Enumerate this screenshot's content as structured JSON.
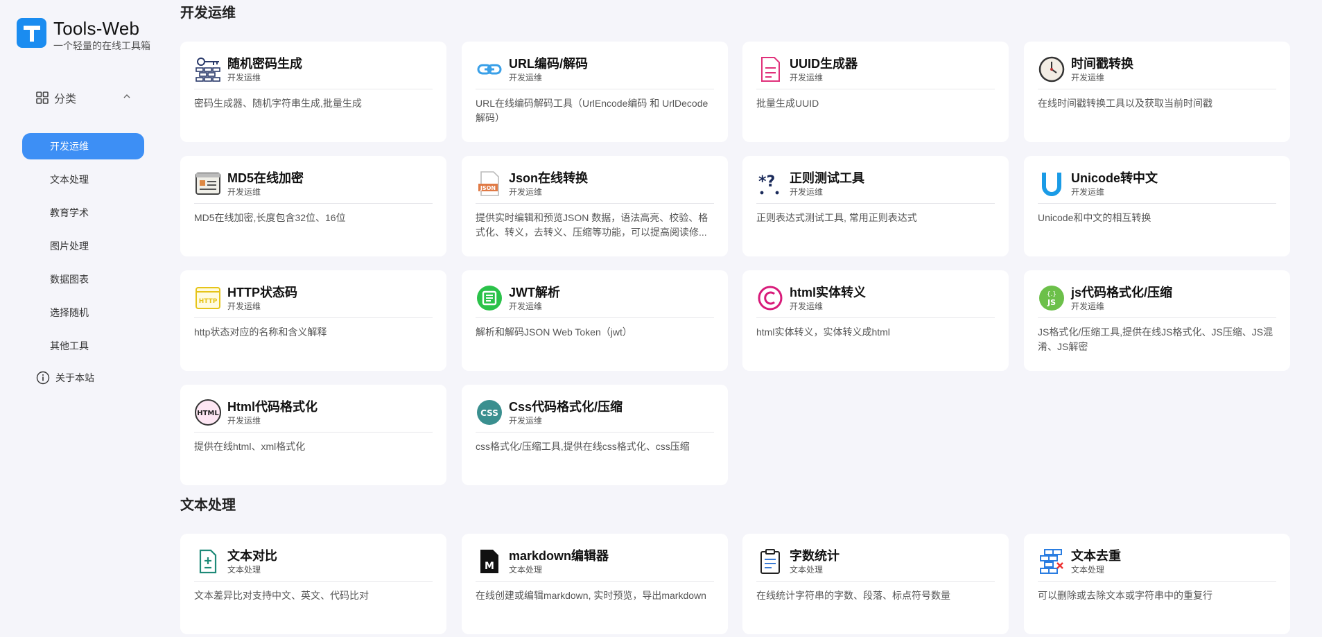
{
  "brand": {
    "title": "Tools-Web",
    "subtitle": "一个轻量的在线工具箱",
    "logo_letter": "T",
    "accent": "#3d8ff5"
  },
  "sidebar": {
    "category_label": "分类",
    "items": [
      {
        "label": "开发运维",
        "active": true
      },
      {
        "label": "文本处理"
      },
      {
        "label": "教育学术"
      },
      {
        "label": "图片处理"
      },
      {
        "label": "数据图表"
      },
      {
        "label": "选择随机"
      },
      {
        "label": "其他工具"
      }
    ],
    "about_label": "关于本站"
  },
  "sections": [
    {
      "title": "开发运维",
      "cards": [
        {
          "title": "随机密码生成",
          "cat": "开发运维",
          "desc": "密码生成器、随机字符串生成,批量生成",
          "icon": "password-icon"
        },
        {
          "title": "URL编码/解码",
          "cat": "开发运维",
          "desc": "URL在线编码解码工具（UrlEncode编码 和 UrlDecode解码）",
          "icon": "link-icon"
        },
        {
          "title": "UUID生成器",
          "cat": "开发运维",
          "desc": "批量生成UUID",
          "icon": "document-icon"
        },
        {
          "title": "时间戳转换",
          "cat": "开发运维",
          "desc": "在线时间戳转换工具以及获取当前时间戳",
          "icon": "clock-icon"
        },
        {
          "title": "MD5在线加密",
          "cat": "开发运维",
          "desc": "MD5在线加密,长度包含32位、16位",
          "icon": "md5-icon"
        },
        {
          "title": "Json在线转换",
          "cat": "开发运维",
          "desc": "提供实时编辑和预览JSON 数据，语法高亮、校验、格式化、转义，去转义、压缩等功能，可以提高阅读修...",
          "icon": "json-file-icon"
        },
        {
          "title": "正则测试工具",
          "cat": "开发运维",
          "desc": "正则表达式测试工具, 常用正则表达式",
          "icon": "regex-icon"
        },
        {
          "title": "Unicode转中文",
          "cat": "开发运维",
          "desc": "Unicode和中文的相互转换",
          "icon": "unicode-icon"
        },
        {
          "title": "HTTP状态码",
          "cat": "开发运维",
          "desc": "http状态对应的名称和含义解释",
          "icon": "http-icon"
        },
        {
          "title": "JWT解析",
          "cat": "开发运维",
          "desc": "解析和解码JSON Web Token（jwt）",
          "icon": "jwt-icon"
        },
        {
          "title": "html实体转义",
          "cat": "开发运维",
          "desc": "html实体转义，实体转义成html",
          "icon": "copyright-icon"
        },
        {
          "title": "js代码格式化/压缩",
          "cat": "开发运维",
          "desc": "JS格式化/压缩工具,提供在线JS格式化、JS压缩、JS混淆、JS解密",
          "icon": "js-icon"
        },
        {
          "title": "Html代码格式化",
          "cat": "开发运维",
          "desc": "提供在线html、xml格式化",
          "icon": "html-icon"
        },
        {
          "title": "Css代码格式化/压缩",
          "cat": "开发运维",
          "desc": "css格式化/压缩工具,提供在线css格式化、css压缩",
          "icon": "css-icon"
        }
      ]
    },
    {
      "title": "文本处理",
      "cards": [
        {
          "title": "文本对比",
          "cat": "文本处理",
          "desc": "文本差异比对支持中文、英文、代码比对",
          "icon": "file-diff-icon"
        },
        {
          "title": "markdown编辑器",
          "cat": "文本处理",
          "desc": "在线创建或编辑markdown, 实时预览，导出markdown",
          "icon": "markdown-icon"
        },
        {
          "title": "字数统计",
          "cat": "文本处理",
          "desc": "在线统计字符串的字数、段落、标点符号数量",
          "icon": "clipboard-icon"
        },
        {
          "title": "文本去重",
          "cat": "文本处理",
          "desc": "可以删除或去除文本或字符串中的重复行",
          "icon": "dedupe-icon"
        }
      ]
    }
  ]
}
